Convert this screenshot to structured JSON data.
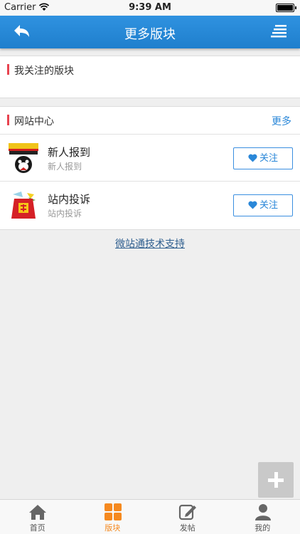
{
  "status_bar": {
    "carrier": "Carrier",
    "time": "9:39 AM"
  },
  "nav": {
    "title": "更多版块"
  },
  "my_boards": {
    "title": "我关注的版块"
  },
  "site_center": {
    "title": "网站中心",
    "more_label": "更多",
    "items": [
      {
        "name": "新人报到",
        "desc": "新人报到",
        "follow_label": "关注",
        "logo": "newcomer-logo"
      },
      {
        "name": "站内投诉",
        "desc": "站内投诉",
        "follow_label": "关注",
        "logo": "complaint-logo"
      }
    ]
  },
  "support_link": "微站通技术支持",
  "tabs": [
    {
      "label": "首页",
      "icon": "home-icon",
      "active": false
    },
    {
      "label": "版块",
      "icon": "grid-icon",
      "active": true
    },
    {
      "label": "发帖",
      "icon": "edit-icon",
      "active": false
    },
    {
      "label": "我的",
      "icon": "user-icon",
      "active": false
    }
  ],
  "colors": {
    "nav_blue": "#1f85d6",
    "accent_orange": "#f5891f",
    "section_marker": "#e8434f",
    "link_blue": "#2a87d8"
  }
}
